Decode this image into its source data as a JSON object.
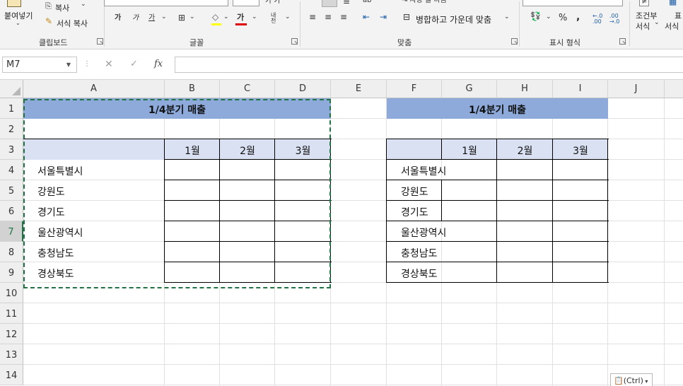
{
  "ribbon": {
    "clipboard": {
      "paste_label": "붙여넣기",
      "copy_label": "복사",
      "format_painter_label": "서식 복사",
      "group_label": "클립보드"
    },
    "font": {
      "bold_glyph": "가",
      "italic_glyph": "가",
      "underline_glyph": "가",
      "font_color_glyph": "가",
      "phonetic_glyph": "내천",
      "group_label": "글꼴"
    },
    "alignment": {
      "merge_center_label": "병합하고 가운데 맞춤",
      "group_label": "맞춤"
    },
    "number": {
      "percent_glyph": "%",
      "comma_glyph": ",",
      "group_label": "표시 형식"
    },
    "styles": {
      "conditional_label_top": "조건부",
      "conditional_label_bottom": "서식",
      "table_label_top": "표",
      "table_label_bottom": "서식"
    }
  },
  "formula_bar": {
    "name_box": "M7",
    "formula": ""
  },
  "sheet": {
    "columns": [
      "A",
      "B",
      "C",
      "D",
      "E",
      "F",
      "G",
      "H",
      "I",
      "J"
    ],
    "rows": [
      "1",
      "2",
      "3",
      "4",
      "5",
      "6",
      "7",
      "8",
      "9",
      "10",
      "11",
      "12",
      "13",
      "14"
    ],
    "selected_row": "7",
    "left_table": {
      "title": "1/4분기 매출",
      "months": [
        "1월",
        "2월",
        "3월"
      ],
      "regions": [
        "서울특별시",
        "강원도",
        "경기도",
        "울산광역시",
        "충청남도",
        "경상북도"
      ]
    },
    "right_table": {
      "title": "1/4분기 매출",
      "months": [
        "1월",
        "2월",
        "3월"
      ],
      "regions": [
        "서울특별시",
        "강원도",
        "경기도",
        "울산광역시",
        "충청남도",
        "경상북도"
      ]
    }
  },
  "paste_options": {
    "label": "(Ctrl)"
  },
  "colors": {
    "title_fill": "#8eaadb",
    "header_fill": "#d9e1f2",
    "selection_green": "#217346"
  }
}
